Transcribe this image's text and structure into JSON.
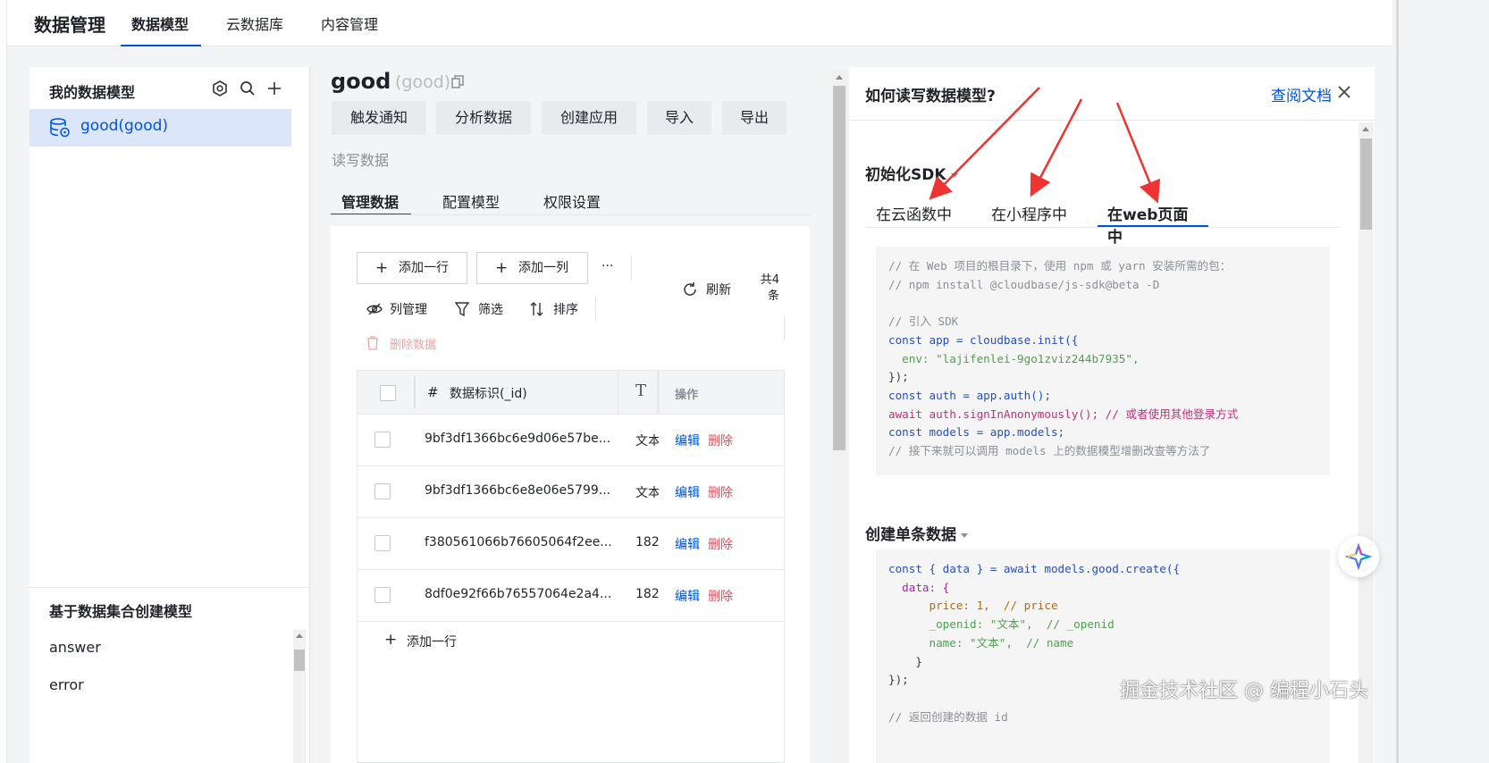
{
  "topnav": {
    "brand": "数据管理",
    "tabs": [
      {
        "label": "数据模型",
        "active": true
      },
      {
        "label": "云数据库",
        "active": false
      },
      {
        "label": "内容管理",
        "active": false
      }
    ]
  },
  "sidebar": {
    "title": "我的数据模型",
    "icons": [
      "settings-icon",
      "search-icon",
      "add-icon"
    ],
    "models": [
      {
        "label": "good(good)",
        "selected": true
      }
    ],
    "collections_title": "基于数据集合创建模型",
    "collections": [
      "answer",
      "error"
    ]
  },
  "main": {
    "title": "good",
    "subtitle": "(good)",
    "actions": [
      "触发通知",
      "分析数据",
      "创建应用",
      "导入",
      "导出"
    ],
    "rw_label": "读写数据",
    "tabs": [
      {
        "label": "管理数据",
        "active": true
      },
      {
        "label": "配置模型",
        "active": false
      },
      {
        "label": "权限设置",
        "active": false
      }
    ],
    "toolbar": {
      "add_row": "添加一行",
      "add_col": "添加一列",
      "more": "···",
      "refresh": "刷新",
      "total": "共4条",
      "col_manage": "列管理",
      "filter": "筛选",
      "sort": "排序",
      "delete_data": "删除数据"
    },
    "table": {
      "headers": {
        "hash": "#",
        "id": "数据标识(_id)",
        "type_icon": "T",
        "ops": "操作"
      },
      "rows": [
        {
          "id": "9bf3df1366bc6e9d06e57be...",
          "t": "文本",
          "edit": "编辑",
          "del": "删除"
        },
        {
          "id": "9bf3df1366bc6e8e06e5799...",
          "t": "文本",
          "edit": "编辑",
          "del": "删除"
        },
        {
          "id": "f380561066b76605064f2ee...",
          "t": "182",
          "edit": "编辑",
          "del": "删除"
        },
        {
          "id": "8df0e92f66b76557064e2a4...",
          "t": "182",
          "edit": "编辑",
          "del": "删除"
        }
      ],
      "add_row": "添加一行"
    }
  },
  "guide": {
    "title": "如何读写数据模型?",
    "doc_link": "查阅文档",
    "sdk_section": "初始化SDK",
    "tabs": [
      {
        "label": "在云函数中",
        "active": false
      },
      {
        "label": "在小程序中",
        "active": false
      },
      {
        "label": "在web页面中",
        "active": true
      }
    ],
    "code1": [
      "// 在 Web 项目的根目录下，使用 npm 或 yarn 安装所需的包：",
      "// npm install @cloudbase/js-sdk@beta -D",
      "",
      "// 引入 SDK",
      "const app = cloudbase.init({",
      "  env: \"lajifenlei-9go1zviz244b7935\",",
      "});",
      "const auth = app.auth();",
      "await auth.signInAnonymously(); // 或者使用其他登录方式",
      "const models = app.models;",
      "// 接下来就可以调用 models 上的数据模型增删改查等方法了"
    ],
    "create_section": "创建单条数据",
    "code2": [
      "const { data } = await models.good.create({",
      "  data: {",
      "      price: 1,  // price",
      "      _openid: \"文本\",  // _openid",
      "      name: \"文本\",  // name",
      "    }",
      "});",
      "",
      "// 返回创建的数据 id"
    ]
  },
  "watermark": "掘金技术社区 @ 编程小石头",
  "colors": {
    "accent": "#0052d9",
    "danger": "#e34d59",
    "annotation_arrow": "#ee3333"
  }
}
